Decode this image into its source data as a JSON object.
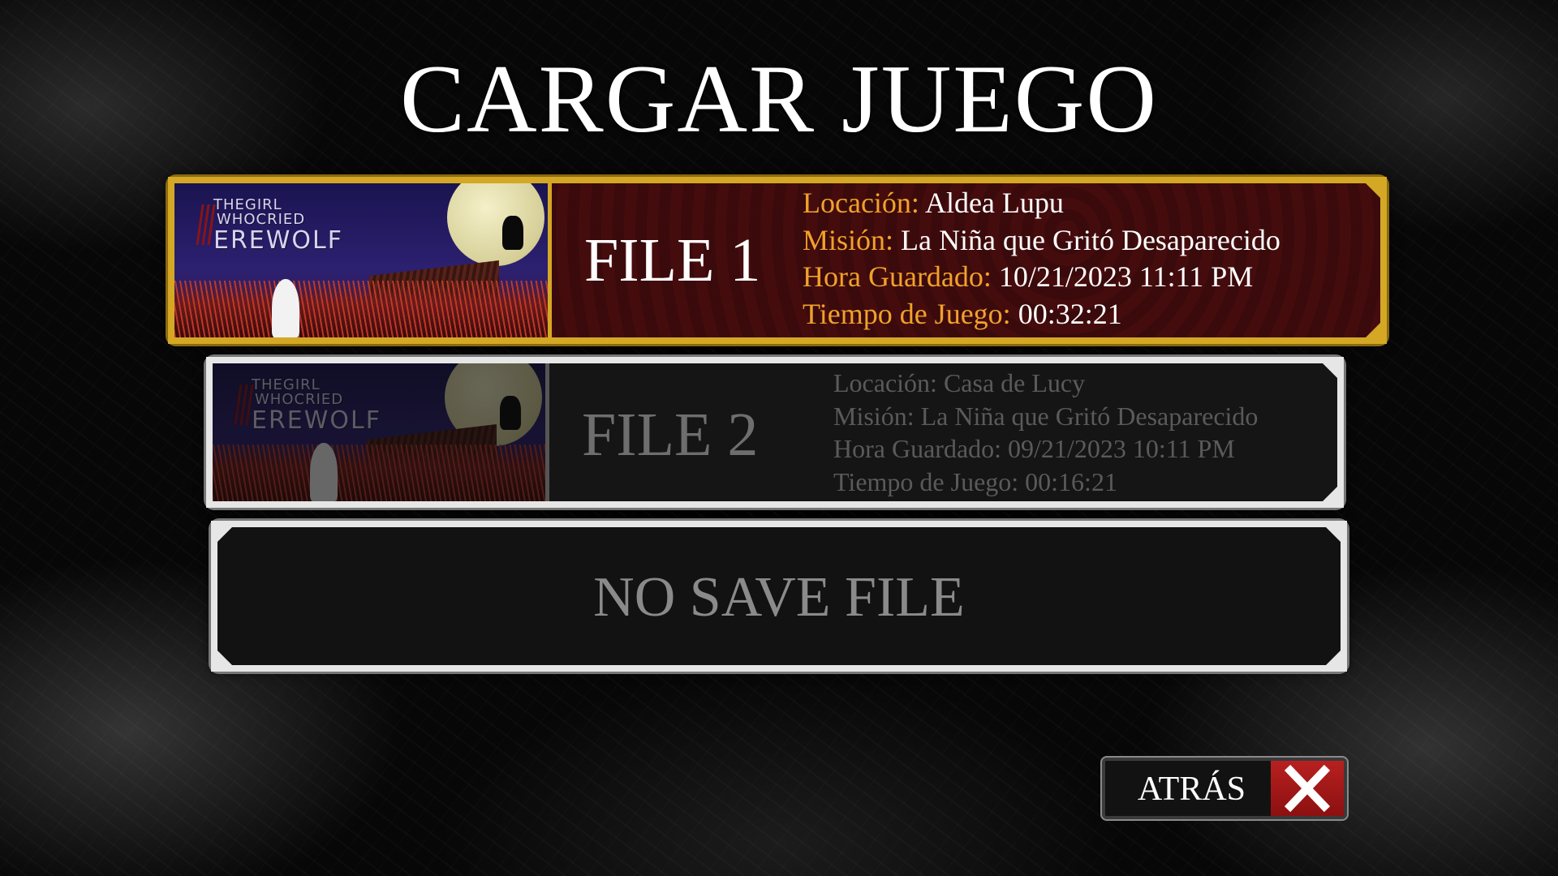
{
  "screen": {
    "title": "CARGAR JUEGO"
  },
  "thumbnail": {
    "logo_line1": "THEGIRL",
    "logo_line2": "WHOCRIED",
    "logo_line3": "EREWOLF"
  },
  "slots": [
    {
      "label": "FILE 1",
      "state": "selected",
      "location_key": "Locación:",
      "location_value": "Aldea Lupu",
      "mission_key": "Misión:",
      "mission_value": "La Niña que Gritó Desaparecido",
      "saved_key": "Hora Guardado:",
      "saved_value": "10/21/2023 11:11 PM",
      "playtime_key": "Tiempo de Juego:",
      "playtime_value": "00:32:21"
    },
    {
      "label": "FILE 2",
      "state": "dimmed",
      "location_key": "Locación:",
      "location_value": "Casa de Lucy",
      "mission_key": "Misión:",
      "mission_value": "La Niña que Gritó Desaparecido",
      "saved_key": "Hora Guardado:",
      "saved_value": "09/21/2023 10:11 PM",
      "playtime_key": "Tiempo de Juego:",
      "playtime_value": "00:16:21"
    },
    {
      "label": "NO SAVE FILE",
      "state": "empty"
    }
  ],
  "back_button": {
    "label": "ATRÁS",
    "icon": "close-x-icon"
  },
  "colors": {
    "selected_border": "#d4a824",
    "selected_key_text": "#f0a22a",
    "selected_background": "#3a0a0c",
    "unselected_border": "#e6e6e6",
    "close_button_red": "#b82020"
  }
}
